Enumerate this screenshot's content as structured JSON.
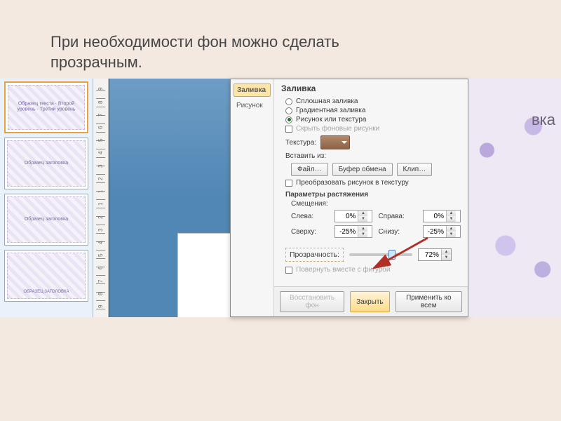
{
  "title": {
    "line1": "При необходимости фон можно сделать",
    "line2": "прозрачным."
  },
  "thumbs": [
    {
      "label": "Образец текста\n· Второй уровень\n· Третий уровень"
    },
    {
      "label": "Образец заголовка"
    },
    {
      "label": "Образец заголовка"
    },
    {
      "label": "ОБРАЗЕЦ ЗАГОЛОВКА"
    }
  ],
  "ruler_ticks": [
    "9",
    "8",
    "7",
    "6",
    "5",
    "4",
    "3",
    "2",
    "1",
    "1",
    "2",
    "3",
    "4",
    "5",
    "6",
    "7",
    "8",
    "9"
  ],
  "dialog": {
    "nav": {
      "fill": "Заливка",
      "picture": "Рисунок"
    },
    "heading": "Заливка",
    "radios": {
      "solid": "Сплошная заливка",
      "gradient": "Градиентная заливка",
      "picture": "Рисунок или текстура",
      "hide": "Скрыть фоновые рисунки"
    },
    "texture_label": "Текстура:",
    "insert_label": "Вставить из:",
    "buttons": {
      "file": "Файл…",
      "clipboard": "Буфер обмена",
      "clip": "Клип…"
    },
    "tile_check": "Преобразовать рисунок в текстуру",
    "stretch_label": "Параметры растяжения",
    "offsets_label": "Смещения:",
    "offsets": {
      "left_l": "Слева:",
      "left_v": "0%",
      "right_l": "Справа:",
      "right_v": "0%",
      "top_l": "Сверху:",
      "top_v": "-25%",
      "bottom_l": "Снизу:",
      "bottom_v": "-25%"
    },
    "transparency_label": "Прозрачность:",
    "transparency_value": "72%",
    "rotate_check": "Повернуть вместе с фигурой",
    "footer": {
      "reset": "Восстановить фон",
      "close": "Закрыть",
      "apply_all": "Применить ко всем"
    }
  },
  "preview_text": "вка"
}
